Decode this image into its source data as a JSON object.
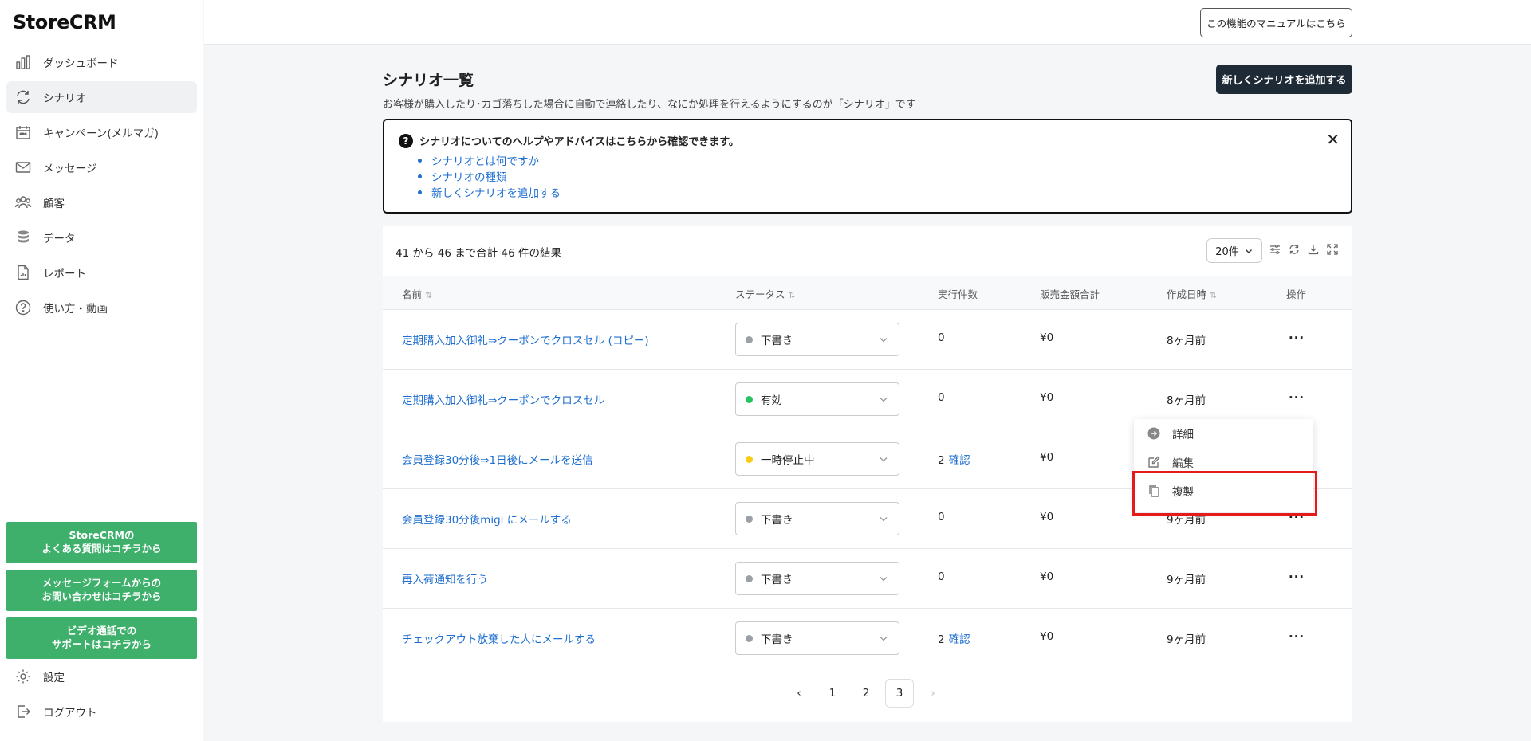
{
  "app": {
    "brand": "StoreCRM"
  },
  "sidebar": {
    "items": [
      {
        "label": "ダッシュボード",
        "icon": "chart-bar-icon"
      },
      {
        "label": "シナリオ",
        "icon": "refresh-icon",
        "active": true
      },
      {
        "label": "キャンペーン(メルマガ)",
        "icon": "calendar-icon"
      },
      {
        "label": "メッセージ",
        "icon": "mail-icon"
      },
      {
        "label": "顧客",
        "icon": "users-icon"
      },
      {
        "label": "データ",
        "icon": "database-icon"
      },
      {
        "label": "レポート",
        "icon": "report-icon"
      },
      {
        "label": "使い方・動画",
        "icon": "help-circle-icon"
      }
    ],
    "support_buttons": [
      "StoreCRMの\nよくある質問はコチラから",
      "メッセージフォームからの\nお問い合わせはコチラから",
      "ビデオ通話での\nサポートはコチラから"
    ],
    "bottom_items": [
      {
        "label": "設定",
        "icon": "gear-icon"
      },
      {
        "label": "ログアウト",
        "icon": "logout-icon"
      }
    ]
  },
  "header": {
    "manual_button": "この機能のマニュアルはこちら"
  },
  "page": {
    "title": "シナリオ一覧",
    "description": "お客様が購入したり･カゴ落ちした場合に自動で連絡したり、なにか処理を行えるようにするのが「シナリオ」です",
    "add_button": "新しくシナリオを追加する"
  },
  "help_box": {
    "title": "シナリオについてのヘルプやアドバイスはこちらから確認できます。",
    "links": [
      "シナリオとは何ですか",
      "シナリオの種類",
      "新しくシナリオを追加する"
    ],
    "close": "✕"
  },
  "table": {
    "result_text": "41 から 46 まで合計 46 件の結果",
    "per_page": "20件",
    "columns": [
      "名前",
      "ステータス",
      "実行件数",
      "販売金額合計",
      "作成日時",
      "操作"
    ],
    "rows": [
      {
        "name": "定期購入加入御礼⇒クーポンでクロスセル (コピー)",
        "status": "下書き",
        "status_color": "#9aa0a6",
        "exec": "0",
        "exec_link": "",
        "sales": "¥0",
        "date": "8ヶ月前",
        "ops": "..."
      },
      {
        "name": "定期購入加入御礼⇒クーポンでクロスセル",
        "status": "有効",
        "status_color": "#22c55e",
        "exec": "0",
        "exec_link": "",
        "sales": "¥0",
        "date": "8ヶ月前",
        "ops": "..."
      },
      {
        "name": "会員登録30分後⇒1日後にメールを送信",
        "status": "一時停止中",
        "status_color": "#facc15",
        "exec": "2",
        "exec_link": "確認",
        "sales": "¥0",
        "date": "",
        "ops": ""
      },
      {
        "name": "会員登録30分後migi にメールする",
        "status": "下書き",
        "status_color": "#9aa0a6",
        "exec": "0",
        "exec_link": "",
        "sales": "¥0",
        "date": "9ヶ月前",
        "ops": "..."
      },
      {
        "name": "再入荷通知を行う",
        "status": "下書き",
        "status_color": "#9aa0a6",
        "exec": "0",
        "exec_link": "",
        "sales": "¥0",
        "date": "9ヶ月前",
        "ops": "..."
      },
      {
        "name": "チェックアウト放棄した人にメールする",
        "status": "下書き",
        "status_color": "#9aa0a6",
        "exec": "2",
        "exec_link": "確認",
        "sales": "¥0",
        "date": "9ヶ月前",
        "ops": "..."
      }
    ]
  },
  "pagination": {
    "prev": "‹",
    "pages": [
      "1",
      "2",
      "3"
    ],
    "current": "3",
    "next": "›"
  },
  "dropdown_menu": {
    "items": [
      {
        "label": "詳細",
        "icon": "arrow-circle-icon"
      },
      {
        "label": "編集",
        "icon": "edit-icon"
      },
      {
        "label": "複製",
        "icon": "copy-icon"
      }
    ]
  }
}
